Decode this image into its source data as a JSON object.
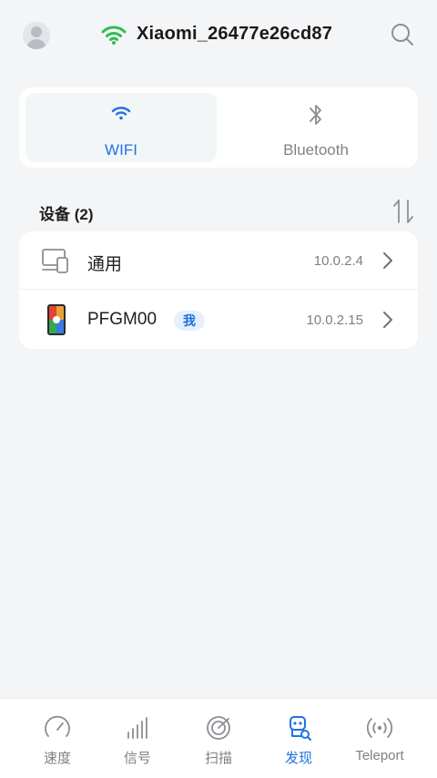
{
  "header": {
    "ssid": "Xiaomi_26477e26cd87",
    "wifi_color": "#2bbf4f",
    "avatar_icon": "avatar-icon",
    "search_icon": "search-icon"
  },
  "tabs": [
    {
      "label": "WIFI",
      "icon": "wifi-icon",
      "active": true
    },
    {
      "label": "Bluetooth",
      "icon": "bluetooth-icon",
      "active": false
    }
  ],
  "devices_section": {
    "title": "设备 (2)",
    "sort_icon": "sort-icon"
  },
  "devices": [
    {
      "name": "通用",
      "ip": "10.0.2.4",
      "icon": "devices-icon",
      "badge": ""
    },
    {
      "name": "PFGM00",
      "ip": "10.0.2.15",
      "icon": "phone-icon",
      "badge": "我"
    }
  ],
  "bottom_nav": [
    {
      "label": "速度",
      "icon": "speedometer-icon",
      "active": false
    },
    {
      "label": "信号",
      "icon": "signal-bars-icon",
      "active": false
    },
    {
      "label": "扫描",
      "icon": "radar-icon",
      "active": false
    },
    {
      "label": "发现",
      "icon": "discover-icon",
      "active": true
    },
    {
      "label": "Teleport",
      "icon": "teleport-icon",
      "active": false
    }
  ],
  "colors": {
    "accent": "#1f73e6",
    "background": "#f4f5f7",
    "inactive": "#7d8085"
  }
}
